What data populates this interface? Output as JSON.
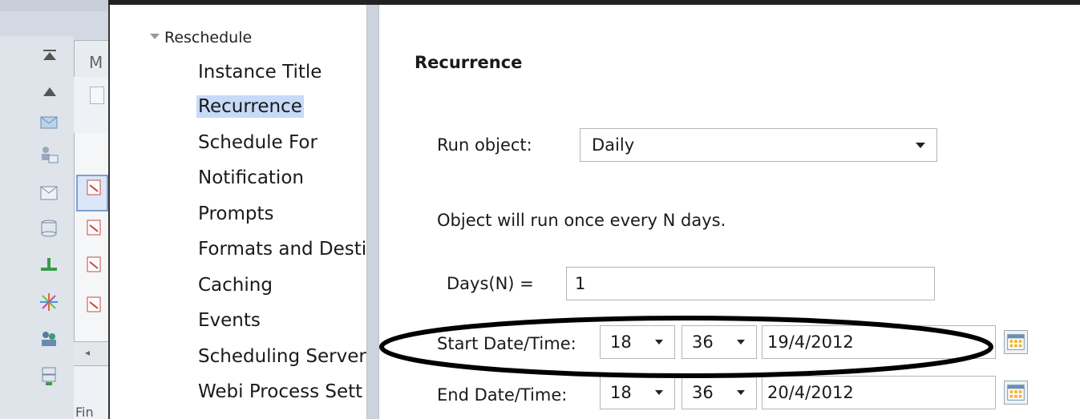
{
  "background_app": {
    "tab_label": "M",
    "bottom_label": "Fin"
  },
  "tree": {
    "root_label": "Reschedule",
    "items": [
      {
        "label": "Instance Title",
        "selected": false
      },
      {
        "label": "Recurrence",
        "selected": true
      },
      {
        "label": "Schedule For",
        "selected": false
      },
      {
        "label": "Notification",
        "selected": false
      },
      {
        "label": "Prompts",
        "selected": false
      },
      {
        "label": "Formats and Desti",
        "selected": false
      },
      {
        "label": "Caching",
        "selected": false
      },
      {
        "label": "Events",
        "selected": false
      },
      {
        "label": "Scheduling Server",
        "selected": false
      },
      {
        "label": "Webi Process Sett",
        "selected": false
      }
    ]
  },
  "recurrence": {
    "title": "Recurrence",
    "run_object_label": "Run object:",
    "run_object_value": "Daily",
    "description": "Object will run once every N days.",
    "days_label": "Days(N) =",
    "days_value": "1",
    "start": {
      "label": "Start Date/Time:",
      "hour": "18",
      "minute": "36",
      "date": "19/4/2012"
    },
    "end": {
      "label": "End Date/Time:",
      "hour": "18",
      "minute": "36",
      "date": "20/4/2012"
    }
  },
  "colors": {
    "selection_highlight": "#c7daf7",
    "annotation_ellipse": "#000000"
  }
}
